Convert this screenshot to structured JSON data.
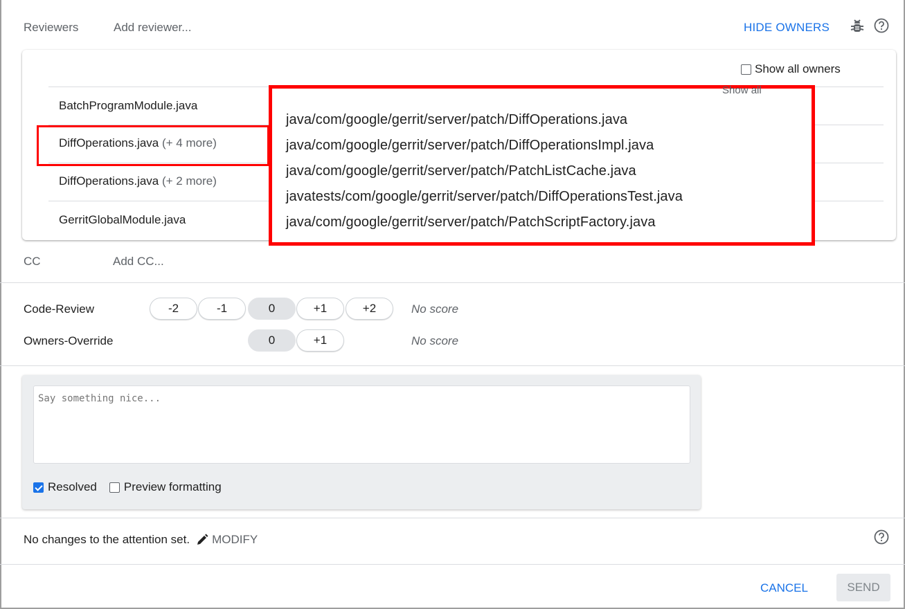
{
  "header": {
    "reviewers_label": "Reviewers",
    "add_reviewer_placeholder": "Add reviewer...",
    "hide_owners": "HIDE OWNERS"
  },
  "owners": {
    "show_all_owners": "Show all owners",
    "files": [
      {
        "name": "BatchProgramModule.java",
        "more": ""
      },
      {
        "name": "DiffOperations.java",
        "more": "(+ 4 more)"
      },
      {
        "name": "DiffOperations.java",
        "more": "(+ 2 more)"
      },
      {
        "name": "GerritGlobalModule.java",
        "more": ""
      }
    ],
    "popup_ghost": "Show all",
    "popup_paths": [
      "java/com/google/gerrit/server/patch/DiffOperations.java",
      "java/com/google/gerrit/server/patch/DiffOperationsImpl.java",
      "java/com/google/gerrit/server/patch/PatchListCache.java",
      "javatests/com/google/gerrit/server/patch/DiffOperationsTest.java",
      "java/com/google/gerrit/server/patch/PatchScriptFactory.java"
    ]
  },
  "cc": {
    "label": "CC",
    "placeholder": "Add CC..."
  },
  "labels": [
    {
      "name": "Code-Review",
      "scores": [
        "-2",
        "-1",
        "0",
        "+1",
        "+2"
      ],
      "selected": "0",
      "status": "No score"
    },
    {
      "name": "Owners-Override",
      "scores": [
        "0",
        "+1"
      ],
      "selected": "0",
      "status": "No score"
    }
  ],
  "comment": {
    "placeholder": "Say something nice...",
    "resolved_label": "Resolved",
    "resolved_checked": true,
    "preview_label": "Preview formatting",
    "preview_checked": false
  },
  "attention": {
    "text": "No changes to the attention set.",
    "modify": "MODIFY"
  },
  "actions": {
    "cancel": "CANCEL",
    "send": "SEND"
  },
  "colors": {
    "accent": "#1a73e8",
    "highlight": "#ff0000"
  }
}
